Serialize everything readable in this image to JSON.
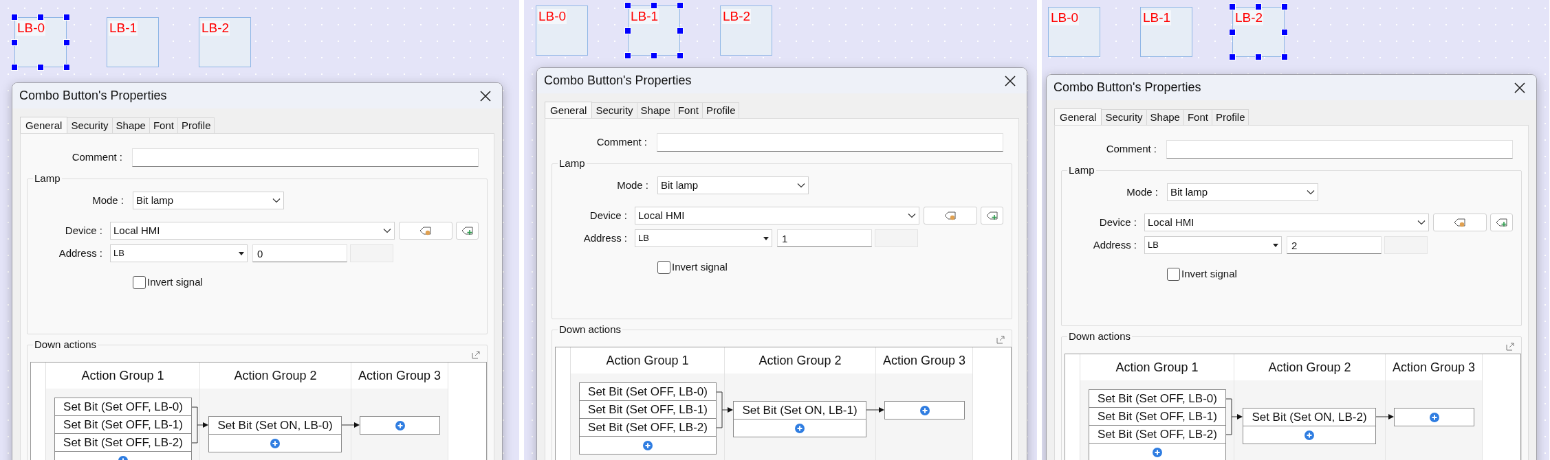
{
  "panels": [
    {
      "canvas_buttons": [
        {
          "label": "LB-0",
          "selected": true
        },
        {
          "label": "LB-1",
          "selected": false
        },
        {
          "label": "LB-2",
          "selected": false
        }
      ],
      "dialog": {
        "title": "Combo Button's Properties",
        "tabs": [
          {
            "label": "General",
            "selected": true
          },
          {
            "label": "Security",
            "selected": false
          },
          {
            "label": "Shape",
            "selected": false
          },
          {
            "label": "Font",
            "selected": false
          },
          {
            "label": "Profile",
            "selected": false
          }
        ],
        "comment_label": "Comment :",
        "lamp": {
          "title": "Lamp",
          "mode_label": "Mode :",
          "mode": "Bit lamp",
          "device_label": "Device :",
          "device": "Local HMI",
          "address_label": "Address :",
          "address_type": "LB",
          "address": "0",
          "invert_label": "Invert signal",
          "invert_checked": false
        },
        "down_actions": {
          "title": "Down actions",
          "groups": [
            {
              "header": "Action Group 1",
              "actions": [
                "Set Bit (Set OFF, LB-0)",
                "Set Bit (Set OFF, LB-1)",
                "Set Bit (Set OFF, LB-2)"
              ]
            },
            {
              "header": "Action Group 2",
              "actions": [
                "Set Bit (Set ON, LB-0)"
              ]
            },
            {
              "header": "Action Group 3"
            }
          ]
        }
      }
    },
    {
      "canvas_buttons": [
        {
          "label": "LB-0",
          "selected": false
        },
        {
          "label": "LB-1",
          "selected": true
        },
        {
          "label": "LB-2",
          "selected": false
        }
      ],
      "dialog": {
        "title": "Combo Button's Properties",
        "tabs": [
          {
            "label": "General",
            "selected": true
          },
          {
            "label": "Security",
            "selected": false
          },
          {
            "label": "Shape",
            "selected": false
          },
          {
            "label": "Font",
            "selected": false
          },
          {
            "label": "Profile",
            "selected": false
          }
        ],
        "comment_label": "Comment :",
        "lamp": {
          "title": "Lamp",
          "mode_label": "Mode :",
          "mode": "Bit lamp",
          "device_label": "Device :",
          "device": "Local HMI",
          "address_label": "Address :",
          "address_type": "LB",
          "address": "1",
          "invert_label": "Invert signal",
          "invert_checked": false
        },
        "down_actions": {
          "title": "Down actions",
          "groups": [
            {
              "header": "Action Group 1",
              "actions": [
                "Set Bit (Set OFF, LB-0)",
                "Set Bit (Set OFF, LB-1)",
                "Set Bit (Set OFF, LB-2)"
              ]
            },
            {
              "header": "Action Group 2",
              "actions": [
                "Set Bit (Set ON, LB-1)"
              ]
            },
            {
              "header": "Action Group 3"
            }
          ]
        }
      }
    },
    {
      "canvas_buttons": [
        {
          "label": "LB-0",
          "selected": false
        },
        {
          "label": "LB-1",
          "selected": false
        },
        {
          "label": "LB-2",
          "selected": true
        }
      ],
      "dialog": {
        "title": "Combo Button's Properties",
        "tabs": [
          {
            "label": "General",
            "selected": true
          },
          {
            "label": "Security",
            "selected": false
          },
          {
            "label": "Shape",
            "selected": false
          },
          {
            "label": "Font",
            "selected": false
          },
          {
            "label": "Profile",
            "selected": false
          }
        ],
        "comment_label": "Comment :",
        "lamp": {
          "title": "Lamp",
          "mode_label": "Mode :",
          "mode": "Bit lamp",
          "device_label": "Device :",
          "device": "Local HMI",
          "address_label": "Address :",
          "address_type": "LB",
          "address": "2",
          "invert_label": "Invert signal",
          "invert_checked": false
        },
        "down_actions": {
          "title": "Down actions",
          "groups": [
            {
              "header": "Action Group 1",
              "actions": [
                "Set Bit (Set OFF, LB-0)",
                "Set Bit (Set OFF, LB-1)",
                "Set Bit (Set OFF, LB-2)"
              ]
            },
            {
              "header": "Action Group 2",
              "actions": [
                "Set Bit (Set ON, LB-2)"
              ]
            },
            {
              "header": "Action Group 3"
            }
          ]
        }
      }
    }
  ]
}
